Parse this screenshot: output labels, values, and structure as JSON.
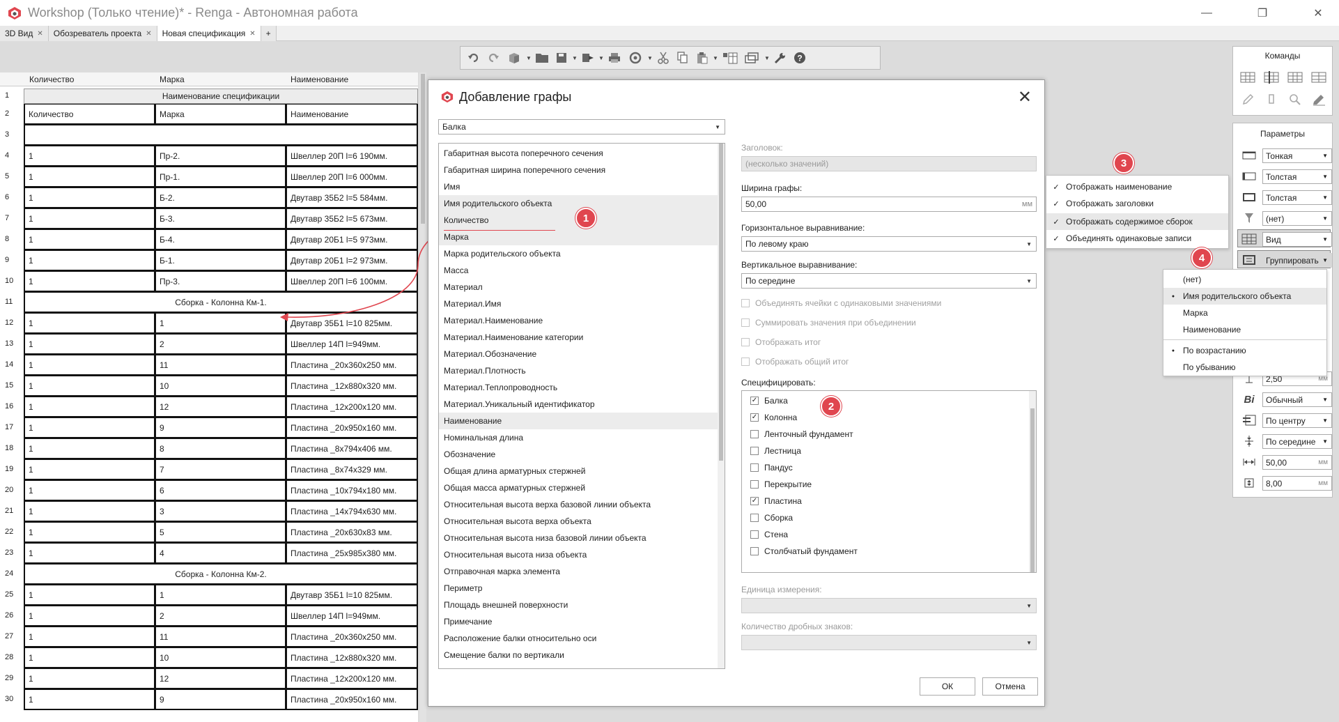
{
  "window": {
    "title": "Workshop (Только чтение)* - Renga - Автономная работа",
    "min_glyph": "—",
    "max_glyph": "❐",
    "close_glyph": "✕"
  },
  "tabs": [
    {
      "label": "3D Вид",
      "active": false
    },
    {
      "label": "Обозреватель проекта",
      "active": false
    },
    {
      "label": "Новая спецификация",
      "active": true
    }
  ],
  "tab_close_glyph": "✕",
  "new_tab_glyph": "+",
  "toolbar_icons": [
    "undo-icon",
    "redo-icon",
    "cube-icon",
    "open-folder-icon",
    "save-icon",
    "export-icon",
    "print-icon",
    "sync-icon",
    "cut-icon",
    "copy-icon",
    "paste-icon",
    "column-view-icon",
    "layers-icon",
    "wrench-icon",
    "help-icon"
  ],
  "sheet": {
    "column_headers": [
      "Количество",
      "Марка",
      "Наименование"
    ],
    "rows": [
      {
        "n": "1",
        "type": "title",
        "text": "Наименование спецификации"
      },
      {
        "n": "2",
        "type": "data",
        "cells": [
          "Количество",
          "Марка",
          "Наименование"
        ]
      },
      {
        "n": "3",
        "type": "merged",
        "text": ""
      },
      {
        "n": "4",
        "type": "data",
        "cells": [
          "1",
          "Пр-2.",
          "Швеллер 20П l=6 190мм."
        ]
      },
      {
        "n": "5",
        "type": "data",
        "cells": [
          "1",
          "Пр-1.",
          "Швеллер 20П l=6 000мм."
        ]
      },
      {
        "n": "6",
        "type": "data",
        "cells": [
          "1",
          "Б-2.",
          "Двутавр 35Б2 l=5 584мм."
        ]
      },
      {
        "n": "7",
        "type": "data",
        "cells": [
          "1",
          "Б-3.",
          "Двутавр 35Б2 l=5 673мм."
        ]
      },
      {
        "n": "8",
        "type": "data",
        "cells": [
          "1",
          "Б-4.",
          "Двутавр 20Б1 l=5 973мм."
        ]
      },
      {
        "n": "9",
        "type": "data",
        "cells": [
          "1",
          "Б-1.",
          "Двутавр 20Б1 l=2 973мм."
        ]
      },
      {
        "n": "10",
        "type": "data",
        "cells": [
          "1",
          "Пр-3.",
          "Швеллер 20П l=6 100мм."
        ]
      },
      {
        "n": "11",
        "type": "merged",
        "text": "Сборка - Колонна Км-1."
      },
      {
        "n": "12",
        "type": "data",
        "cells": [
          "1",
          "1",
          "Двутавр 35Б1 l=10 825мм."
        ]
      },
      {
        "n": "13",
        "type": "data",
        "cells": [
          "1",
          "2",
          "Швеллер 14П l=949мм."
        ]
      },
      {
        "n": "14",
        "type": "data",
        "cells": [
          "1",
          "11",
          "Пластина _20x360x250 мм."
        ]
      },
      {
        "n": "15",
        "type": "data",
        "cells": [
          "1",
          "10",
          "Пластина _12x880x320 мм."
        ]
      },
      {
        "n": "16",
        "type": "data",
        "cells": [
          "1",
          "12",
          "Пластина _12x200x120 мм."
        ]
      },
      {
        "n": "17",
        "type": "data",
        "cells": [
          "1",
          "9",
          "Пластина _20x950x160 мм."
        ]
      },
      {
        "n": "18",
        "type": "data",
        "cells": [
          "1",
          "8",
          "Пластина _8x794x406 мм."
        ]
      },
      {
        "n": "19",
        "type": "data",
        "cells": [
          "1",
          "7",
          "Пластина _8x74x329 мм."
        ]
      },
      {
        "n": "20",
        "type": "data",
        "cells": [
          "1",
          "6",
          "Пластина _10x794x180 мм."
        ]
      },
      {
        "n": "21",
        "type": "data",
        "cells": [
          "1",
          "3",
          "Пластина _14x794x630 мм."
        ]
      },
      {
        "n": "22",
        "type": "data",
        "cells": [
          "1",
          "5",
          "Пластина _20x630x83 мм."
        ]
      },
      {
        "n": "23",
        "type": "data",
        "cells": [
          "1",
          "4",
          "Пластина _25x985x380 мм."
        ]
      },
      {
        "n": "24",
        "type": "merged",
        "text": "Сборка - Колонна Км-2."
      },
      {
        "n": "25",
        "type": "data",
        "cells": [
          "1",
          "1",
          "Двутавр 35Б1 l=10 825мм."
        ]
      },
      {
        "n": "26",
        "type": "data",
        "cells": [
          "1",
          "2",
          "Швеллер 14П l=949мм."
        ]
      },
      {
        "n": "27",
        "type": "data",
        "cells": [
          "1",
          "11",
          "Пластина _20x360x250 мм."
        ]
      },
      {
        "n": "28",
        "type": "data",
        "cells": [
          "1",
          "10",
          "Пластина _12x880x320 мм."
        ]
      },
      {
        "n": "29",
        "type": "data",
        "cells": [
          "1",
          "12",
          "Пластина _12x200x120 мм."
        ]
      },
      {
        "n": "30",
        "type": "data",
        "cells": [
          "1",
          "9",
          "Пластина _20x950x160 мм."
        ]
      }
    ]
  },
  "dialog": {
    "title": "Добавление графы",
    "close_glyph": "✕",
    "object_type": "Балка",
    "properties": [
      {
        "label": "Габаритная высота поперечного сечения",
        "group": false
      },
      {
        "label": "Габаритная ширина поперечного сечения",
        "group": false
      },
      {
        "label": "Имя",
        "group": false
      },
      {
        "label": "Имя родительского объекта",
        "group": true
      },
      {
        "label": "Количество",
        "group": true
      },
      {
        "label": "Марка",
        "group": true
      },
      {
        "label": "Марка родительского объекта",
        "group": false
      },
      {
        "label": "Масса",
        "group": false
      },
      {
        "label": "Материал",
        "group": false
      },
      {
        "label": "Материал.Имя",
        "group": false
      },
      {
        "label": "Материал.Наименование",
        "group": false
      },
      {
        "label": "Материал.Наименование категории",
        "group": false
      },
      {
        "label": "Материал.Обозначение",
        "group": false
      },
      {
        "label": "Материал.Плотность",
        "group": false
      },
      {
        "label": "Материал.Теплопроводность",
        "group": false
      },
      {
        "label": "Материал.Уникальный идентификатор",
        "group": false
      },
      {
        "label": "Наименование",
        "group": true
      },
      {
        "label": "Номинальная длина",
        "group": false
      },
      {
        "label": "Обозначение",
        "group": false
      },
      {
        "label": "Общая длина арматурных стержней",
        "group": false
      },
      {
        "label": "Общая масса арматурных стержней",
        "group": false
      },
      {
        "label": "Относительная высота верха базовой линии объекта",
        "group": false
      },
      {
        "label": "Относительная высота верха объекта",
        "group": false
      },
      {
        "label": "Относительная высота низа базовой линии объекта",
        "group": false
      },
      {
        "label": "Относительная высота низа объекта",
        "group": false
      },
      {
        "label": "Отправочная марка элемента",
        "group": false
      },
      {
        "label": "Периметр",
        "group": false
      },
      {
        "label": "Площадь внешней поверхности",
        "group": false
      },
      {
        "label": "Примечание",
        "group": false
      },
      {
        "label": "Расположение балки относительно оси",
        "group": false
      },
      {
        "label": "Смещение балки по вертикали",
        "group": false
      }
    ],
    "header_label": "Заголовок:",
    "header_value": "(несколько значений)",
    "width_label": "Ширина графы:",
    "width_value": "50,00",
    "width_unit": "мм",
    "halign_label": "Горизонтальное выравнивание:",
    "halign_value": "По левому краю",
    "valign_label": "Вертикальное выравнивание:",
    "valign_value": "По середине",
    "options": [
      "Объединять ячейки с одинаковыми значениями",
      "Суммировать значения при объединении",
      "Отображать итог",
      "Отображать общий итог"
    ],
    "specify_label": "Специфицировать:",
    "specify_items": [
      {
        "label": "Балка",
        "checked": true
      },
      {
        "label": "Колонна",
        "checked": true
      },
      {
        "label": "Ленточный фундамент",
        "checked": false
      },
      {
        "label": "Лестница",
        "checked": false
      },
      {
        "label": "Пандус",
        "checked": false
      },
      {
        "label": "Перекрытие",
        "checked": false
      },
      {
        "label": "Пластина",
        "checked": true
      },
      {
        "label": "Сборка",
        "checked": false
      },
      {
        "label": "Стена",
        "checked": false
      },
      {
        "label": "Столбчатый фундамент",
        "checked": false
      }
    ],
    "unit_label": "Единица измерения:",
    "decimals_label": "Количество дробных знаков:",
    "ok_label": "ОК",
    "cancel_label": "Отмена"
  },
  "commands_panel": {
    "title": "Команды"
  },
  "params_panel": {
    "title": "Параметры",
    "line1": "Тонкая",
    "line2": "Толстая",
    "line3": "Толстая",
    "filter": "(нет)",
    "view": "Вид",
    "group": "Группировать",
    "size_value": "2,50",
    "size_unit": "мм",
    "font_style": "Обычный",
    "halign": "По центру",
    "valign": "По середине",
    "width_value": "50,00",
    "width_unit": "мм",
    "height_value": "8,00",
    "height_unit": "мм"
  },
  "view_menu": [
    {
      "label": "Отображать наименование",
      "checked": true,
      "highlight": false
    },
    {
      "label": "Отображать заголовки",
      "checked": true,
      "highlight": false
    },
    {
      "label": "Отображать содержимое сборок",
      "checked": true,
      "highlight": true
    },
    {
      "label": "Объединять одинаковые записи",
      "checked": true,
      "highlight": false
    }
  ],
  "group_menu": [
    {
      "label": "(нет)",
      "checked": false,
      "highlight": false
    },
    {
      "label": "Имя родительского объекта",
      "checked": true,
      "highlight": true
    },
    {
      "label": "Марка",
      "checked": false,
      "highlight": false
    },
    {
      "label": "Наименование",
      "checked": false,
      "highlight": false
    },
    {
      "label": "По возрастанию",
      "checked": true,
      "highlight": false
    },
    {
      "label": "По убыванию",
      "checked": false,
      "highlight": false
    }
  ],
  "badges": [
    "1",
    "2",
    "3",
    "4"
  ],
  "colors": {
    "accent_red": "#e0464f",
    "table_border": "#111111",
    "window_bg": "#dcdcdc"
  }
}
